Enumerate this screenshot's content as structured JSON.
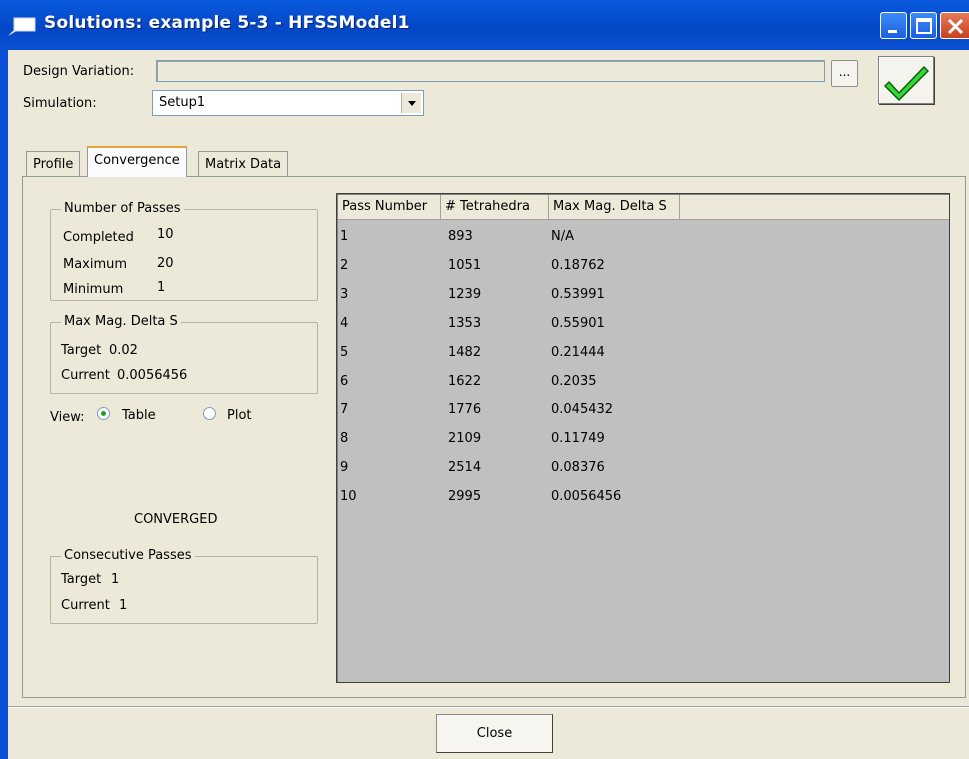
{
  "window": {
    "title": "Solutions: example 5-3 - HFSSModel1"
  },
  "form": {
    "design_variation_label": "Design Variation:",
    "design_variation_value": "",
    "browse_label": "...",
    "simulation_label": "Simulation:",
    "simulation_value": "Setup1"
  },
  "tabs": [
    {
      "label": "Profile"
    },
    {
      "label": "Convergence",
      "selected": true
    },
    {
      "label": "Matrix Data"
    }
  ],
  "passes": {
    "title": "Number of Passes",
    "completed_label": "Completed",
    "completed_value": "10",
    "maximum_label": "Maximum",
    "maximum_value": "20",
    "minimum_label": "Minimum",
    "minimum_value": "1"
  },
  "delta": {
    "title": "Max Mag. Delta S",
    "target_label": "Target",
    "target_value": "0.02",
    "current_label": "Current",
    "current_value": "0.0056456"
  },
  "view": {
    "label": "View:",
    "table_label": "Table",
    "plot_label": "Plot",
    "selected": "Table"
  },
  "status_text": "CONVERGED",
  "consecutive": {
    "title": "Consecutive Passes",
    "target_label": "Target",
    "target_value": "1",
    "current_label": "Current",
    "current_value": "1"
  },
  "table": {
    "headers": [
      "Pass Number",
      "# Tetrahedra",
      "Max Mag. Delta S"
    ],
    "rows": [
      [
        "1",
        "893",
        "N/A"
      ],
      [
        "2",
        "1051",
        "0.18762"
      ],
      [
        "3",
        "1239",
        "0.53991"
      ],
      [
        "4",
        "1353",
        "0.55901"
      ],
      [
        "5",
        "1482",
        "0.21444"
      ],
      [
        "6",
        "1622",
        "0.2035"
      ],
      [
        "7",
        "1776",
        "0.045432"
      ],
      [
        "8",
        "2109",
        "0.11749"
      ],
      [
        "9",
        "2514",
        "0.08376"
      ],
      [
        "10",
        "2995",
        "0.0056456"
      ]
    ]
  },
  "close_label": "Close",
  "icons": {
    "title": "window-app-icon",
    "status": "green-check-icon"
  }
}
